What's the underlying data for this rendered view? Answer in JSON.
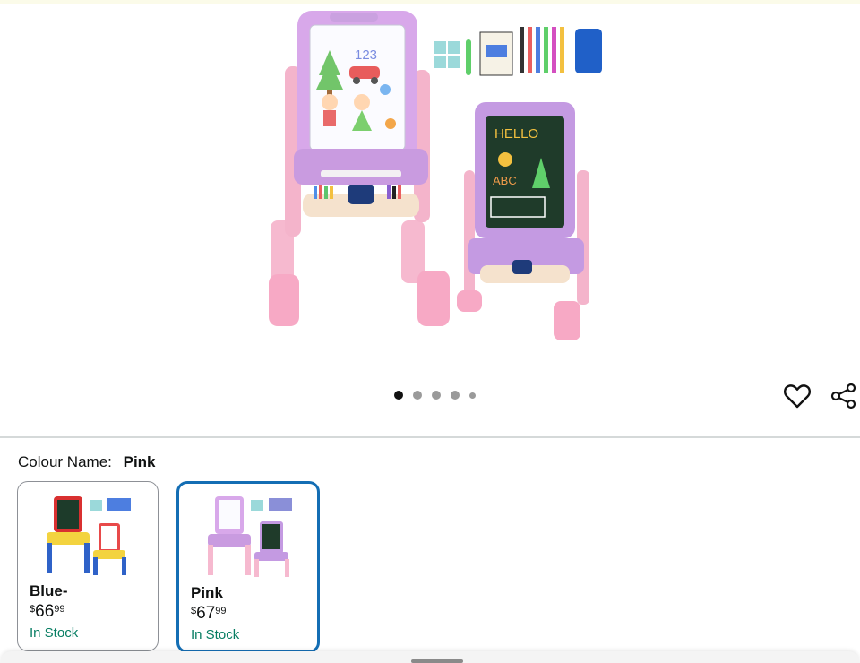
{
  "product": {
    "image": {
      "alt": "Pink children's painting easel with whiteboard and chalkboard sides and accessories"
    },
    "carousel": {
      "count": 5,
      "active_index": 0
    }
  },
  "actions": {
    "wishlist_icon": "heart-icon",
    "share_icon": "share-icon"
  },
  "colour": {
    "label": "Colour Name:",
    "selected": "Pink",
    "options": [
      {
        "name": "Blue-",
        "price_symbol": "$",
        "price_whole": "66",
        "price_fraction": "99",
        "availability": "In Stock",
        "selected": false
      },
      {
        "name": "Pink",
        "price_symbol": "$",
        "price_whole": "67",
        "price_fraction": "99",
        "availability": "In Stock",
        "selected": true
      }
    ]
  },
  "colors": {
    "selected_border": "#146eb4",
    "stock_green": "#067d62",
    "dot_active": "#111111",
    "dot_inactive": "#9a9a9a"
  }
}
